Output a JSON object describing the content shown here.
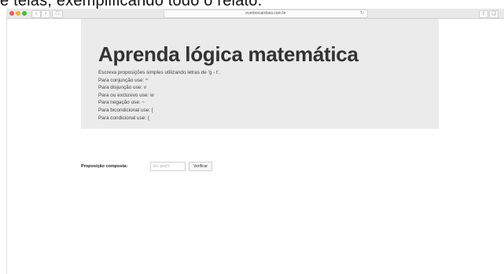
{
  "overlay_caption": "e telas, exemplificando todo o relato.",
  "browser": {
    "url": "evertoncardoso.com.br"
  },
  "jumbotron": {
    "title": "Aprenda lógica matemática",
    "lines": [
      "Escreva proposições simples utilizando letras de 'g - t'.",
      "Para conjunção use: ^",
      "Para disjunção use: v",
      "Para ou exclusivo use: w",
      "Para negação use: ~",
      "Para bicondicional use: [",
      "Para condicional use: {"
    ]
  },
  "form": {
    "label": "Proposição composta:",
    "input_placeholder": "Ex: pvq^r",
    "input_value": "",
    "button_label": "Verificar"
  },
  "icons": {
    "traffic_lights": [
      "#ef5b52",
      "#e7b23c",
      "#43bd49"
    ],
    "back": "chevron-left-icon",
    "forward": "chevron-right-icon",
    "sidebar": "sidebar-icon",
    "reload": "reload-icon",
    "share": "share-icon",
    "tabs": "tabs-icon"
  }
}
